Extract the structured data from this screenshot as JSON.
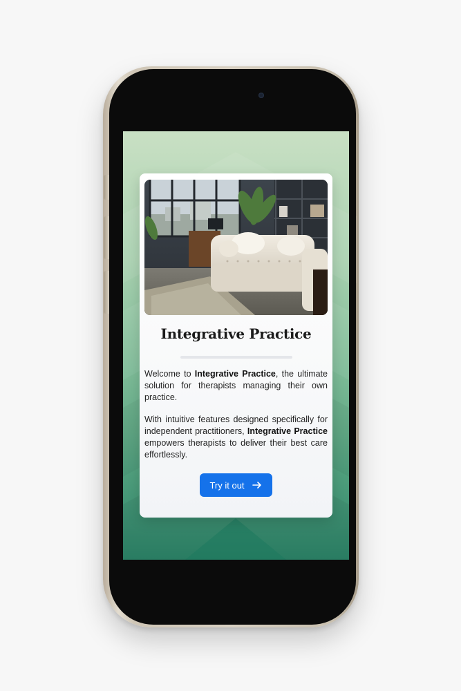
{
  "card": {
    "title": "Integrative Practice",
    "paragraph1": {
      "before": "Welcome to ",
      "bold": "Integrative Practice",
      "after": ", the ultimate solution for therapists managing their own practice."
    },
    "paragraph2": {
      "before": "With intuitive features designed specifically for independent practitioners, ",
      "bold": "Integrative Practice",
      "after": " empowers therapists to deliver their best care effortlessly."
    },
    "cta_label": "Try it out",
    "cta_icon": "arrow-right-icon"
  },
  "colors": {
    "accent": "#1572ea",
    "background_top": "#c9e0c4",
    "background_bottom": "#2c8368",
    "phone_frame": "#d8d0c2"
  }
}
